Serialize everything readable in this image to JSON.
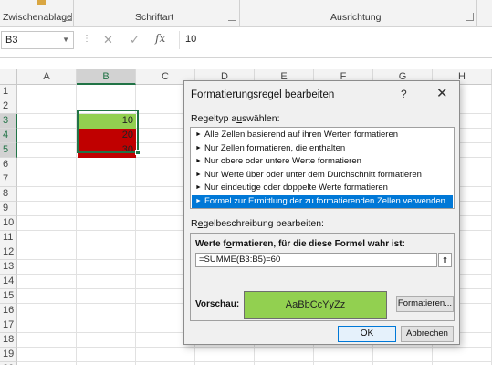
{
  "ribbon": {
    "groups": [
      "Zwischenablage",
      "Schriftart",
      "Ausrichtung"
    ]
  },
  "formula_bar": {
    "name_box": "B3",
    "cancel_icon": "cancel-icon",
    "enter_icon": "check-icon",
    "function_label": "fx",
    "value": "10"
  },
  "grid": {
    "columns": [
      "A",
      "B",
      "C",
      "D",
      "E",
      "F",
      "G",
      "H"
    ],
    "rows": [
      "1",
      "2",
      "3",
      "4",
      "5",
      "6",
      "7",
      "8",
      "9",
      "10",
      "11",
      "12",
      "13",
      "14",
      "15",
      "16",
      "17",
      "18",
      "19",
      "20"
    ],
    "selected_column": "B",
    "selected_rows": [
      "3",
      "4",
      "5"
    ],
    "cells": [
      {
        "ref": "B3",
        "value": "10",
        "fill": "#92d050"
      },
      {
        "ref": "B4",
        "value": "20",
        "fill": "#c00000"
      },
      {
        "ref": "B5",
        "value": "30",
        "fill": "#c00000"
      }
    ]
  },
  "dialog": {
    "title": "Formatierungsregel bearbeiten",
    "help": "?",
    "close": "✕",
    "rule_type_label_pre": "Regeltyp a",
    "rule_type_label_u": "u",
    "rule_type_label_post": "swählen:",
    "rule_types": [
      "Alle Zellen basierend auf ihren Werten formatieren",
      "Nur Zellen formatieren, die enthalten",
      "Nur obere oder untere Werte formatieren",
      "Nur Werte über oder unter dem Durchschnitt formatieren",
      "Nur eindeutige oder doppelte Werte formatieren",
      "Formel zur Ermittlung der zu formatierenden Zellen verwenden"
    ],
    "selected_rule_index": 5,
    "rule_desc_label_pre": "R",
    "rule_desc_label_u": "e",
    "rule_desc_label_post": "gelbeschreibung bearbeiten:",
    "formula_label_pre": "Werte f",
    "formula_label_u": "o",
    "formula_label_post": "rmatieren, für die diese Formel wahr ist:",
    "formula": "=SUMME(B3:B5)=60",
    "preview_label": "Vorschau:",
    "preview_text": "AaBbCcYyZz",
    "preview_fill": "#92d050",
    "format_button": "Formatieren...",
    "ok_button": "OK",
    "cancel_button": "Abbrechen"
  }
}
